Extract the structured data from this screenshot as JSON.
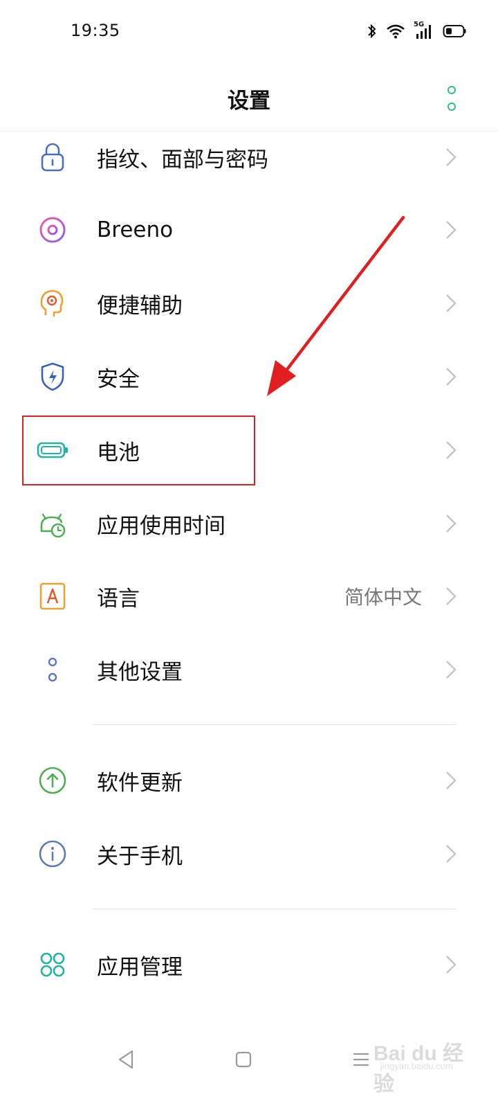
{
  "status_bar": {
    "time": "19:35",
    "icons": [
      "bluetooth-icon",
      "wifi-icon",
      "signal-5g-icon",
      "battery-icon"
    ],
    "network_label": "5G"
  },
  "header": {
    "title": "设置",
    "more_icon": "more-vertical-icon"
  },
  "colors": {
    "accent": "#2ec27e",
    "highlight": "#e02020",
    "text": "#111111",
    "secondary_text": "#777777"
  },
  "settings": {
    "items": [
      {
        "label": "指纹、面部与密码",
        "icon": "lock-icon"
      },
      {
        "label": "Breeno",
        "icon": "breeno-icon"
      },
      {
        "label": "便捷辅助",
        "icon": "assist-icon"
      },
      {
        "label": "安全",
        "icon": "shield-icon"
      },
      {
        "label": "电池",
        "icon": "battery-icon"
      },
      {
        "label": "应用使用时间",
        "icon": "app-usage-icon"
      },
      {
        "label": "语言",
        "icon": "language-icon",
        "value": "简体中文"
      },
      {
        "label": "其他设置",
        "icon": "other-settings-icon"
      },
      {
        "label": "软件更新",
        "icon": "update-icon"
      },
      {
        "label": "关于手机",
        "icon": "info-icon"
      },
      {
        "label": "应用管理",
        "icon": "apps-icon"
      }
    ]
  },
  "annotation": {
    "highlighted_item": "电池"
  },
  "nav_bar": {
    "icons": [
      "back-icon",
      "home-icon",
      "menu-icon"
    ]
  },
  "watermark": {
    "text": "Bai du 经验",
    "sub": "jingyan.baidu.com"
  }
}
